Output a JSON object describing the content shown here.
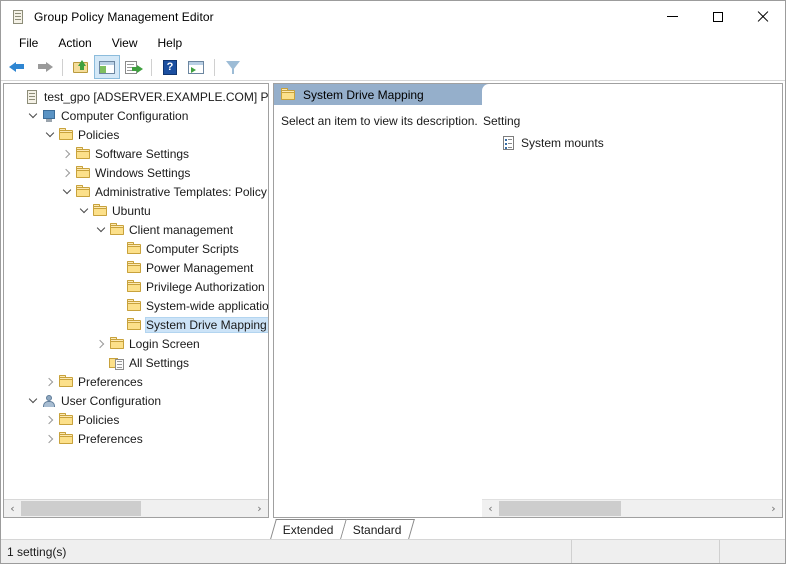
{
  "window": {
    "title": "Group Policy Management Editor",
    "title_icon": "policy-scroll-icon",
    "controls": {
      "minimize": "minimize-icon",
      "maximize": "maximize-icon",
      "close": "close-icon"
    }
  },
  "menubar": {
    "items": [
      {
        "label": "File"
      },
      {
        "label": "Action"
      },
      {
        "label": "View"
      },
      {
        "label": "Help"
      }
    ]
  },
  "toolbar": {
    "buttons": [
      {
        "name": "back-icon",
        "active": false
      },
      {
        "name": "forward-icon",
        "active": false
      },
      {
        "name": "up-one-level-icon",
        "active": false
      },
      {
        "name": "show-hide-tree-icon",
        "active": true
      },
      {
        "name": "export-list-icon",
        "active": false
      },
      {
        "name": "help-icon",
        "active": false
      },
      {
        "name": "properties-icon",
        "active": false
      },
      {
        "name": "filter-icon",
        "active": false
      }
    ],
    "help_glyph": "?"
  },
  "tree": {
    "items": [
      {
        "label": "test_gpo [ADSERVER.EXAMPLE.COM] Policy",
        "indent": 0,
        "twisty": "none",
        "icon": "policy-scroll-icon",
        "selected": false
      },
      {
        "label": "Computer Configuration",
        "indent": 1,
        "twisty": "expanded",
        "icon": "monitor-icon",
        "selected": false
      },
      {
        "label": "Policies",
        "indent": 2,
        "twisty": "expanded",
        "icon": "folder-icon",
        "selected": false
      },
      {
        "label": "Software Settings",
        "indent": 3,
        "twisty": "collapsed",
        "icon": "folder-icon",
        "selected": false
      },
      {
        "label": "Windows Settings",
        "indent": 3,
        "twisty": "collapsed",
        "icon": "folder-icon",
        "selected": false
      },
      {
        "label": "Administrative Templates: Policy d",
        "indent": 3,
        "twisty": "expanded",
        "icon": "folder-icon",
        "selected": false
      },
      {
        "label": "Ubuntu",
        "indent": 4,
        "twisty": "expanded",
        "icon": "folder-icon",
        "selected": false
      },
      {
        "label": "Client management",
        "indent": 5,
        "twisty": "expanded",
        "icon": "folder-icon",
        "selected": false
      },
      {
        "label": "Computer Scripts",
        "indent": 6,
        "twisty": "none",
        "icon": "folder-icon",
        "selected": false
      },
      {
        "label": "Power Management",
        "indent": 6,
        "twisty": "none",
        "icon": "folder-icon",
        "selected": false
      },
      {
        "label": "Privilege Authorization",
        "indent": 6,
        "twisty": "none",
        "icon": "folder-icon",
        "selected": false
      },
      {
        "label": "System-wide applicatio",
        "indent": 6,
        "twisty": "none",
        "icon": "folder-icon",
        "selected": false
      },
      {
        "label": "System Drive Mapping",
        "indent": 6,
        "twisty": "none",
        "icon": "folder-icon",
        "selected": true
      },
      {
        "label": "Login Screen",
        "indent": 5,
        "twisty": "collapsed",
        "icon": "folder-icon",
        "selected": false
      },
      {
        "label": "All Settings",
        "indent": 5,
        "twisty": "none",
        "icon": "all-settings-icon",
        "selected": false
      },
      {
        "label": "Preferences",
        "indent": 2,
        "twisty": "collapsed",
        "icon": "folder-icon",
        "selected": false
      },
      {
        "label": "User Configuration",
        "indent": 1,
        "twisty": "expanded",
        "icon": "user-icon",
        "selected": false
      },
      {
        "label": "Policies",
        "indent": 2,
        "twisty": "collapsed",
        "icon": "folder-icon",
        "selected": false
      },
      {
        "label": "Preferences",
        "indent": 2,
        "twisty": "collapsed",
        "icon": "folder-icon",
        "selected": false
      }
    ],
    "scrollbar": {
      "left_arrow": "‹",
      "right_arrow": "›"
    }
  },
  "detail": {
    "banner": {
      "title": "System Drive Mapping",
      "icon": "folder-icon"
    },
    "description": "Select an item to view its description.",
    "column_header": "Setting",
    "rows": [
      {
        "label": "System mounts",
        "icon": "setting-document-icon"
      }
    ],
    "scrollbar": {
      "left_arrow": "‹",
      "right_arrow": "›"
    }
  },
  "tabs": [
    {
      "label": "Extended",
      "active": true
    },
    {
      "label": "Standard",
      "active": false
    }
  ],
  "statusbar": {
    "left": "1 setting(s)",
    "middle": "",
    "right": ""
  },
  "colors": {
    "banner": "#95afcb",
    "selection": "#cce3f7",
    "toolbar_active": "#d4e8f7",
    "statusbar": "#efefef",
    "scroll_thumb": "#cdcdcd"
  }
}
